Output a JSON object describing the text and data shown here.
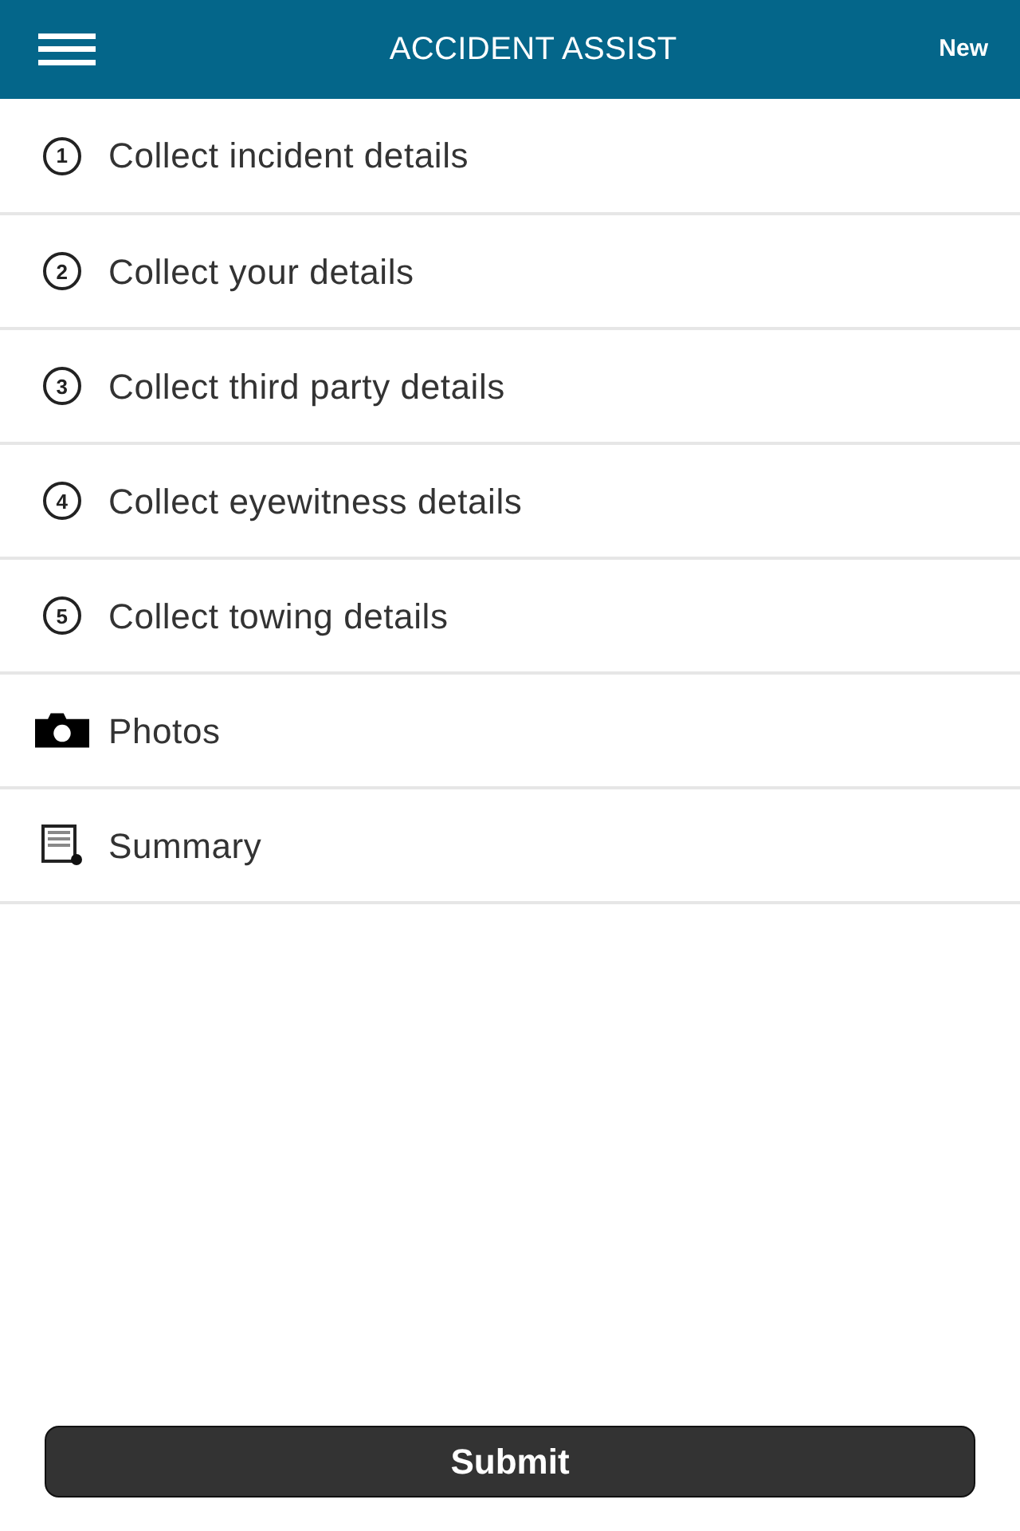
{
  "header": {
    "title": "ACCIDENT ASSIST",
    "action": "New"
  },
  "menu": [
    {
      "kind": "step",
      "number": "1",
      "label": "Collect incident details"
    },
    {
      "kind": "step",
      "number": "2",
      "label": "Collect your details"
    },
    {
      "kind": "step",
      "number": "3",
      "label": "Collect third party details"
    },
    {
      "kind": "step",
      "number": "4",
      "label": "Collect eyewitness details"
    },
    {
      "kind": "step",
      "number": "5",
      "label": "Collect towing details"
    },
    {
      "kind": "camera",
      "label": "Photos"
    },
    {
      "kind": "document",
      "label": "Summary"
    }
  ],
  "submit": "Submit"
}
